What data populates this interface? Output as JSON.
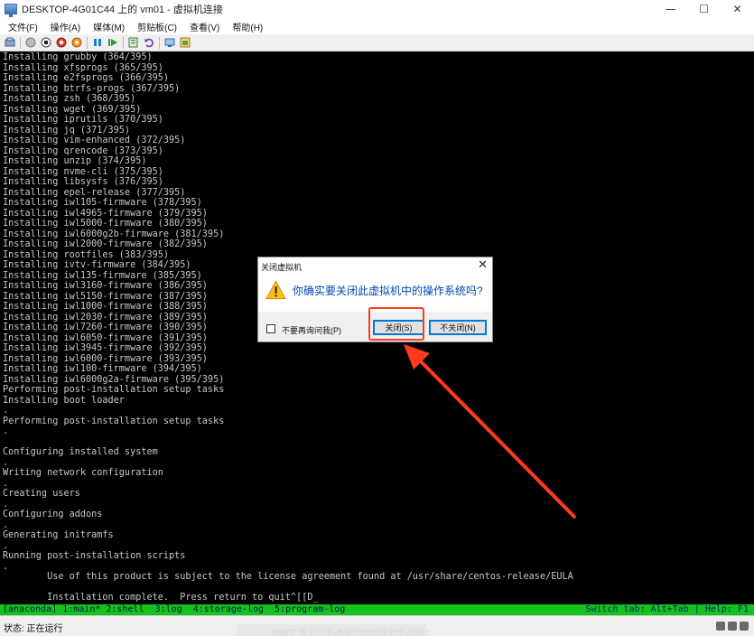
{
  "window": {
    "title": "DESKTOP-4G01C44 上的 vm01 - 虚拟机连接",
    "minimize": "—",
    "maximize": "☐",
    "close": "✕"
  },
  "menu": [
    "文件(F)",
    "操作(A)",
    "媒体(M)",
    "剪贴板(C)",
    "查看(V)",
    "帮助(H)"
  ],
  "toolbar_icons": [
    "ctrl-alt-del-icon",
    "start-icon",
    "turn-off-icon",
    "shutdown-icon",
    "save-icon",
    "pause-icon",
    "reset-icon",
    "checkpoint-icon",
    "revert-icon",
    "enhanced-session-icon",
    "share-icon"
  ],
  "console": {
    "lines": [
      "Installing grubby (364/395)",
      "Installing xfsprogs (365/395)",
      "Installing e2fsprogs (366/395)",
      "Installing btrfs-progs (367/395)",
      "Installing zsh (368/395)",
      "Installing wget (369/395)",
      "Installing iprutils (370/395)",
      "Installing jq (371/395)",
      "Installing vim-enhanced (372/395)",
      "Installing qrencode (373/395)",
      "Installing unzip (374/395)",
      "Installing nvme-cli (375/395)",
      "Installing libsysfs (376/395)",
      "Installing epel-release (377/395)",
      "Installing iwl105-firmware (378/395)",
      "Installing iwl4965-firmware (379/395)",
      "Installing iwl5000-firmware (380/395)",
      "Installing iwl6000g2b-firmware (381/395)",
      "Installing iwl2000-firmware (382/395)",
      "Installing rootfiles (383/395)",
      "Installing ivtv-firmware (384/395)",
      "Installing iwl135-firmware (385/395)",
      "Installing iwl3160-firmware (386/395)",
      "Installing iwl5150-firmware (387/395)",
      "Installing iwl1000-firmware (388/395)",
      "Installing iwl2030-firmware (389/395)",
      "Installing iwl7260-firmware (390/395)",
      "Installing iwl6050-firmware (391/395)",
      "Installing iwl3945-firmware (392/395)",
      "Installing iwl6000-firmware (393/395)",
      "Installing iwl100-firmware (394/395)",
      "Installing iwl6000g2a-firmware (395/395)",
      "Performing post-installation setup tasks",
      "Installing boot loader",
      ".",
      "Performing post-installation setup tasks",
      ".",
      "",
      "Configuring installed system",
      ".",
      "Writing network configuration",
      ".",
      "Creating users",
      ".",
      "Configuring addons",
      ".",
      "Generating initramfs",
      ".",
      "Running post-installation scripts",
      ".",
      "        Use of this product is subject to the license agreement found at /usr/share/centos-release/EULA",
      "",
      "        Installation complete.  Press return to quit^[[D_"
    ],
    "tmux_left": "[anaconda] 1:main* 2:shell  3:log  4:storage-log  5:program-log",
    "tmux_right": "Switch tab: Alt+Tab | Help: F1"
  },
  "status": {
    "label": "状态: 正在运行",
    "ghost": "你确实要关闭此虚拟机中的操作系统吗?"
  },
  "dialog": {
    "title": "关闭虚拟机",
    "close_glyph": "✕",
    "message": "你确实要关闭此虚拟机中的操作系统吗?",
    "checkbox_label": "不要再询问我(P)",
    "checkbox_checked": false,
    "confirm_label": "关闭(S)",
    "cancel_label": "不关闭(N)"
  },
  "colors": {
    "console_bg": "#000000",
    "console_text": "#c8c8c8",
    "tmux_bg": "#15c21b",
    "annotation": "#ff3b1f",
    "dialog_message": "#0047b8"
  }
}
